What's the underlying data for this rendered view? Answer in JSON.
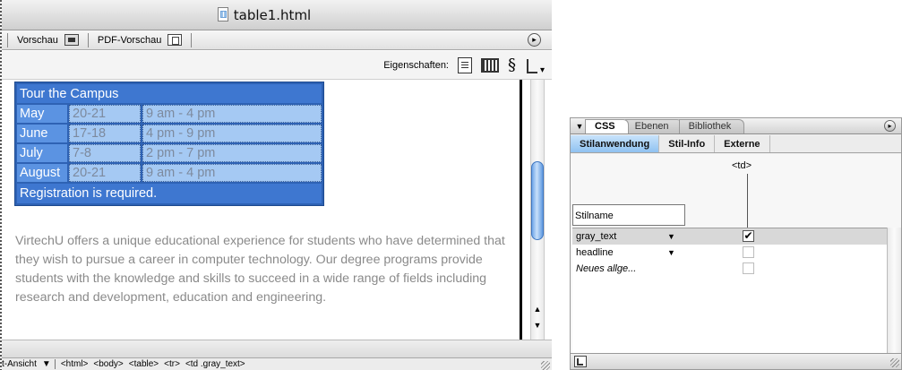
{
  "document": {
    "title": "table1.html",
    "toolbar": {
      "preview_label": "Vorschau",
      "pdf_preview_label": "PDF-Vorschau"
    },
    "properties_label": "Eigenschaften:",
    "table": {
      "header": "Tour the Campus",
      "rows": [
        {
          "month": "May",
          "dates": "20-21",
          "time": "9 am - 4 pm"
        },
        {
          "month": "June",
          "dates": "17-18",
          "time": "4 pm - 9 pm"
        },
        {
          "month": "July",
          "dates": "7-8",
          "time": "2 pm - 7 pm"
        },
        {
          "month": "August",
          "dates": "20-21",
          "time": "9 am - 4 pm"
        }
      ],
      "footer": "Registration is required."
    },
    "paragraph": "VirtechU offers a unique educational experience for students who have determined that they wish to pursue a career in computer technology. Our degree programs provide students with the knowledge and skills to succeed in a wide range of fields including research and development, education and engineering.",
    "status": {
      "view_mode": "t-Ansicht",
      "tags": [
        "<html>",
        "<body>",
        "<table>",
        "<tr>",
        "<td .gray_text>"
      ]
    }
  },
  "css_panel": {
    "tabs": [
      "CSS",
      "Ebenen",
      "Bibliothek"
    ],
    "active_tab": "CSS",
    "subtabs": [
      "Stilanwendung",
      "Stil-Info",
      "Externe"
    ],
    "active_subtab": "Stilanwendung",
    "column_tag": "<td>",
    "stilname_header": "Stilname",
    "styles": [
      {
        "name": "gray_text",
        "checked": true,
        "selected": true
      },
      {
        "name": "headline",
        "checked": false,
        "selected": false
      }
    ],
    "new_style_label": "Neues allge..."
  },
  "colors": {
    "table_border": "#2e62b4",
    "header_bg": "#3e77d0",
    "month_bg": "#5b93e2",
    "cell_bg": "#a5c9f3",
    "selected_subtab": "#8fc2f1"
  }
}
